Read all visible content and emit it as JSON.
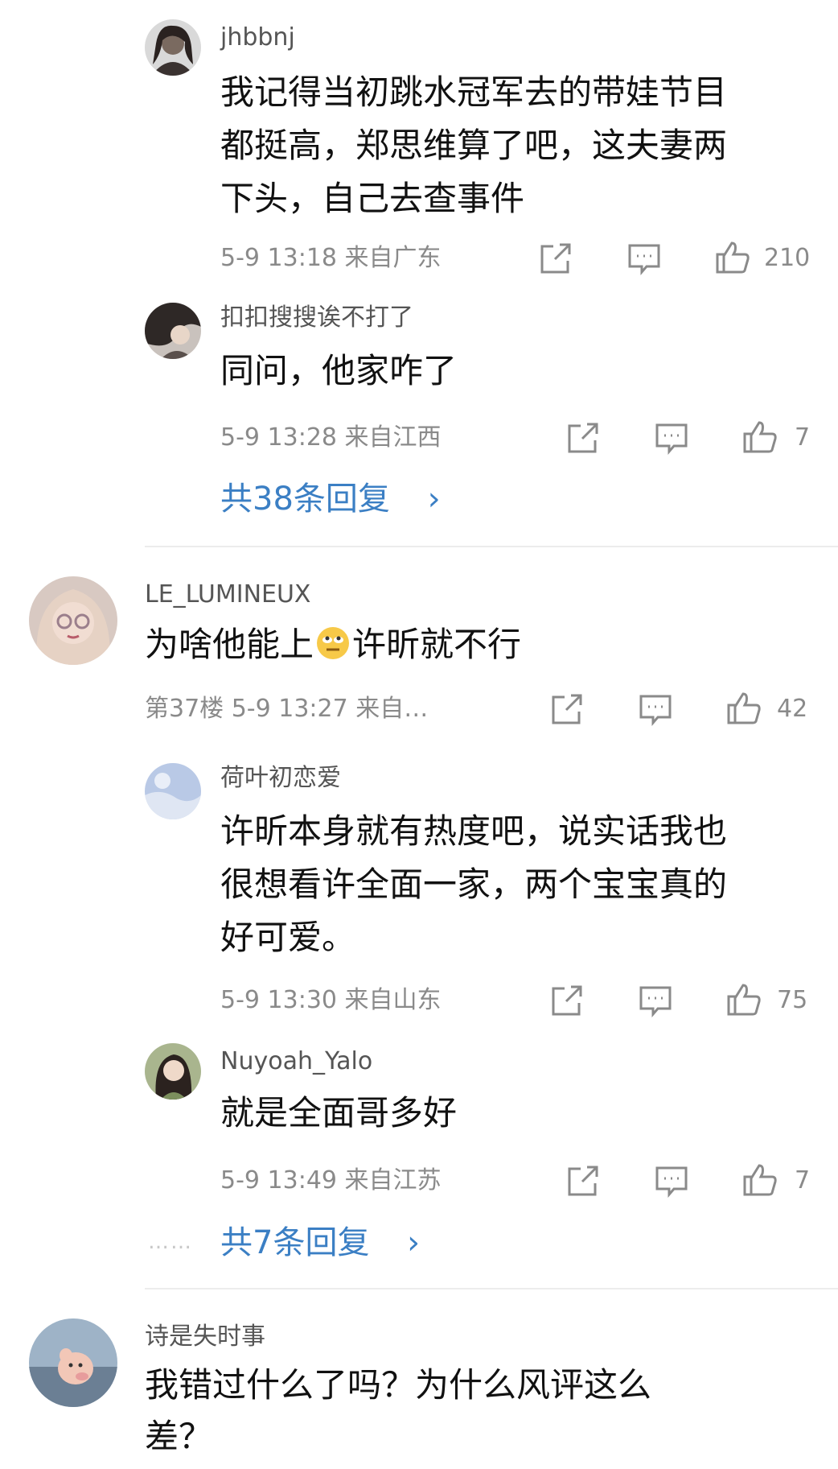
{
  "colors": {
    "link": "#3b7fc4",
    "meta": "#8a8a8a",
    "text": "#111111",
    "divider": "#ececec"
  },
  "icons": {
    "share": "share-icon",
    "reply": "comment-icon",
    "like": "like-icon"
  },
  "c1": {
    "user": "jhbbnj",
    "lines": [
      "我记得当初跳水冠军去的带娃节目",
      "都挺高，郑思维算了吧，这夫妻两",
      "下头，自己去查事件"
    ],
    "meta": "5-9  13:18  来自广东",
    "likes": "210"
  },
  "c2": {
    "user": "扣扣搜搜诶不打了",
    "lines": [
      "同问，他家咋了"
    ],
    "meta": "5-9  13:28  来自江西",
    "likes": "7"
  },
  "more1": "共38条回复",
  "c3": {
    "user": "LE_LUMINEUX",
    "text_a": "为啥他能上",
    "text_b": "许昕就不行",
    "meta": "第37楼  5-9  13:27  来自…",
    "likes": "42"
  },
  "c4": {
    "user": "荷叶初恋爱",
    "lines": [
      "许昕本身就有热度吧，说实话我也",
      "很想看许全面一家，两个宝宝真的",
      "好可爱。"
    ],
    "meta": "5-9  13:30  来自山东",
    "likes": "75"
  },
  "c5": {
    "user": "Nuyoah_Yalo",
    "lines": [
      "就是全面哥多好"
    ],
    "meta": "5-9  13:49  来自江苏",
    "likes": "7"
  },
  "more2": "共7条回复",
  "more_chevron": "›",
  "dots": "……",
  "c6": {
    "user": "诗是失时事",
    "lines": [
      "我错过什么了吗？为什么风评这么",
      "差？"
    ]
  }
}
